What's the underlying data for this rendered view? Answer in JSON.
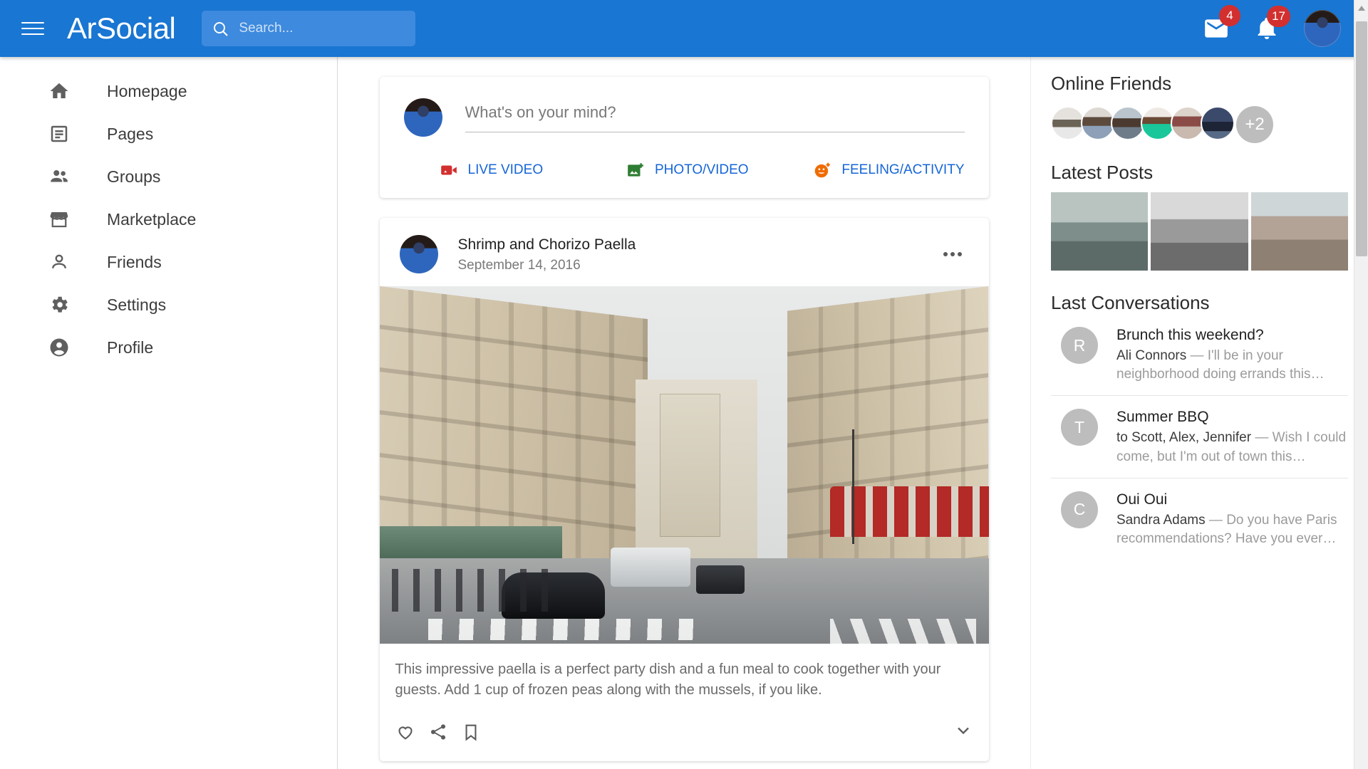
{
  "header": {
    "brand": "ArSocial",
    "menu_icon": "hamburger-menu-icon",
    "search": {
      "placeholder": "Search...",
      "value": "",
      "icon": "search-icon"
    },
    "mail": {
      "icon": "mail-icon",
      "badge": "4"
    },
    "notifications": {
      "icon": "bell-icon",
      "badge": "17"
    },
    "avatar": "user-avatar",
    "accent_color": "#1976d2",
    "badge_color": "#d32f2f"
  },
  "sidebar": {
    "items": [
      {
        "label": "Homepage",
        "icon": "home-icon"
      },
      {
        "label": "Pages",
        "icon": "article-icon"
      },
      {
        "label": "Groups",
        "icon": "people-icon"
      },
      {
        "label": "Marketplace",
        "icon": "store-icon"
      },
      {
        "label": "Friends",
        "icon": "person-icon"
      },
      {
        "label": "Settings",
        "icon": "gear-icon"
      },
      {
        "label": "Profile",
        "icon": "account-circle-icon"
      }
    ]
  },
  "composer": {
    "placeholder": "What's on your mind?",
    "value": "",
    "actions": [
      {
        "label": "LIVE VIDEO",
        "icon": "video-camera-icon",
        "color": "#d32f2f"
      },
      {
        "label": "PHOTO/VIDEO",
        "icon": "photo-add-icon",
        "color": "#2e7d32"
      },
      {
        "label": "FEELING/ACTIVITY",
        "icon": "emoji-icon",
        "color": "#ef6c00"
      }
    ],
    "link_color": "#1565d8"
  },
  "post": {
    "title": "Shrimp and Chorizo Paella",
    "date": "September 14, 2016",
    "more_icon": "more-options-icon",
    "image_alt": "paris-street-photo",
    "body": "This impressive paella is a perfect party dish and a fun meal to cook together with your guests. Add 1 cup of frozen peas along with the mussels, if you like.",
    "actions": [
      {
        "icon": "heart-icon"
      },
      {
        "icon": "share-icon"
      },
      {
        "icon": "bookmark-icon"
      }
    ],
    "expand_icon": "chevron-down-icon"
  },
  "right_rail": {
    "online_friends_title": "Online Friends",
    "friends": [
      {
        "name": "friend-avatar-1"
      },
      {
        "name": "friend-avatar-2"
      },
      {
        "name": "friend-avatar-3"
      },
      {
        "name": "friend-avatar-4"
      },
      {
        "name": "friend-avatar-5"
      },
      {
        "name": "friend-avatar-6"
      }
    ],
    "friends_overflow": "+2",
    "latest_posts_title": "Latest Posts",
    "latest_posts": [
      {
        "name": "cafe-window-thumbnail"
      },
      {
        "name": "street-portrait-thumbnail"
      },
      {
        "name": "market-arcade-thumbnail"
      }
    ],
    "conversations_title": "Last Conversations",
    "conversations": [
      {
        "initial": "R",
        "title": "Brunch this weekend?",
        "sender": "Ali Connors",
        "preview": " — I'll be in your neighborhood doing errands this…"
      },
      {
        "initial": "T",
        "title": "Summer BBQ",
        "sender": "to Scott, Alex, Jennifer",
        "preview": " — Wish I could come, but I'm out of town this…"
      },
      {
        "initial": "C",
        "title": "Oui Oui",
        "sender": "Sandra Adams",
        "preview": " — Do you have Paris recommendations? Have you ever…"
      }
    ]
  }
}
